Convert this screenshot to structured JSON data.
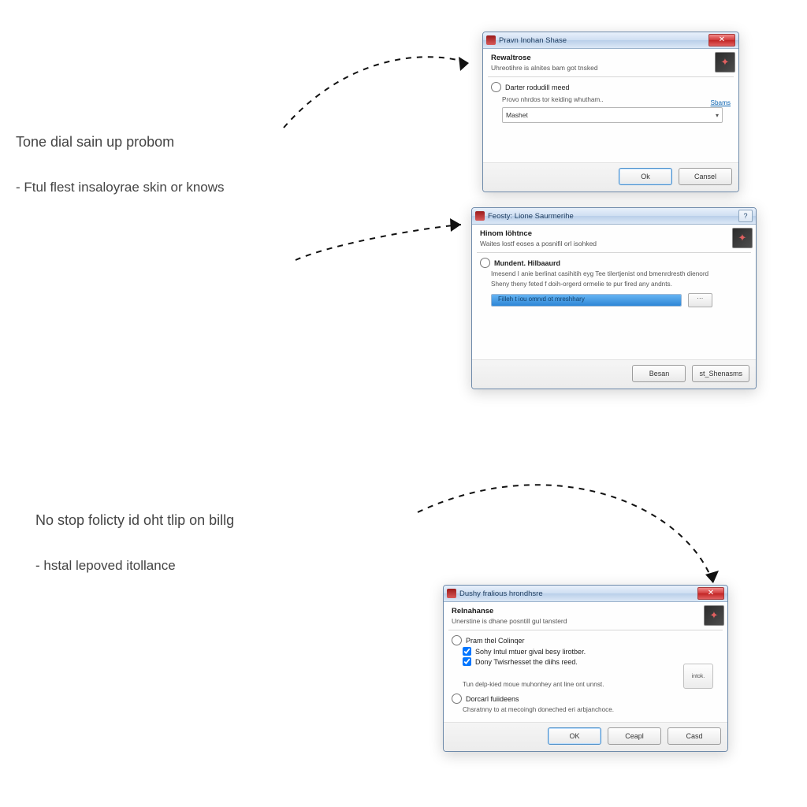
{
  "captions": {
    "heading1": "Tone dial sain up probom",
    "bullet1": "- Ftul flest insaloyrae skin or knows",
    "heading2": "No stop folicty id oht tlip on billg",
    "bullet2": "- hstal lepoved itollance"
  },
  "dialog1": {
    "title": "Pravn Inohan Shase",
    "section_title": "Rewaltrose",
    "section_sub": "Uhreotihre is alnites bam got tnsked",
    "radio_label": "Darter rodudill meed",
    "field_label": "Provo nhrdos tor keiding whutham..",
    "link_text": "Sbams",
    "dropdown_value": "Mashet",
    "ok": "Ok",
    "cancel": "Cansel"
  },
  "dialog2": {
    "title": "Feosty: Lione Saurmerihe",
    "section_title": "Hinom löhtnce",
    "section_sub": "Waites lostf eoses a posnifil orl isohked",
    "radio_label": "Mundent. Hilbaaurd",
    "desc1": "Imesend I anie berlinat casihitih eyg Tee tilertjenist ond bmenrdresth dienord",
    "desc2": "Sheny theny feted f doih-orgerd ormelie te pur fired any andnts.",
    "progress_label": "Filleh t iou omrvd ot mreshhary",
    "btn1": "Besan",
    "btn2": "st_Shenasms"
  },
  "dialog3": {
    "title": "Dushy fralious hrondhsre",
    "section_title": "Relnahanse",
    "section_sub": "Unerstine is dhane posntill gul tansterd",
    "radio1_label": "Pram thel Colinqer",
    "check1_label": "Sohy Intul mtuer gival besy lirotber.",
    "check2_label": "Dony Twisrhesset the diihs reed.",
    "side_btn": "intok.",
    "note": "Tun delp-kied moue muhonhey ant line ont unnst.",
    "radio2_label": "Dorcarl fuiideens",
    "radio2_sub": "Chsratnny to at mecoingh doneched eri arbjanchoce.",
    "ok": "OK",
    "btn2": "Ceapl",
    "btn3": "Casd"
  }
}
